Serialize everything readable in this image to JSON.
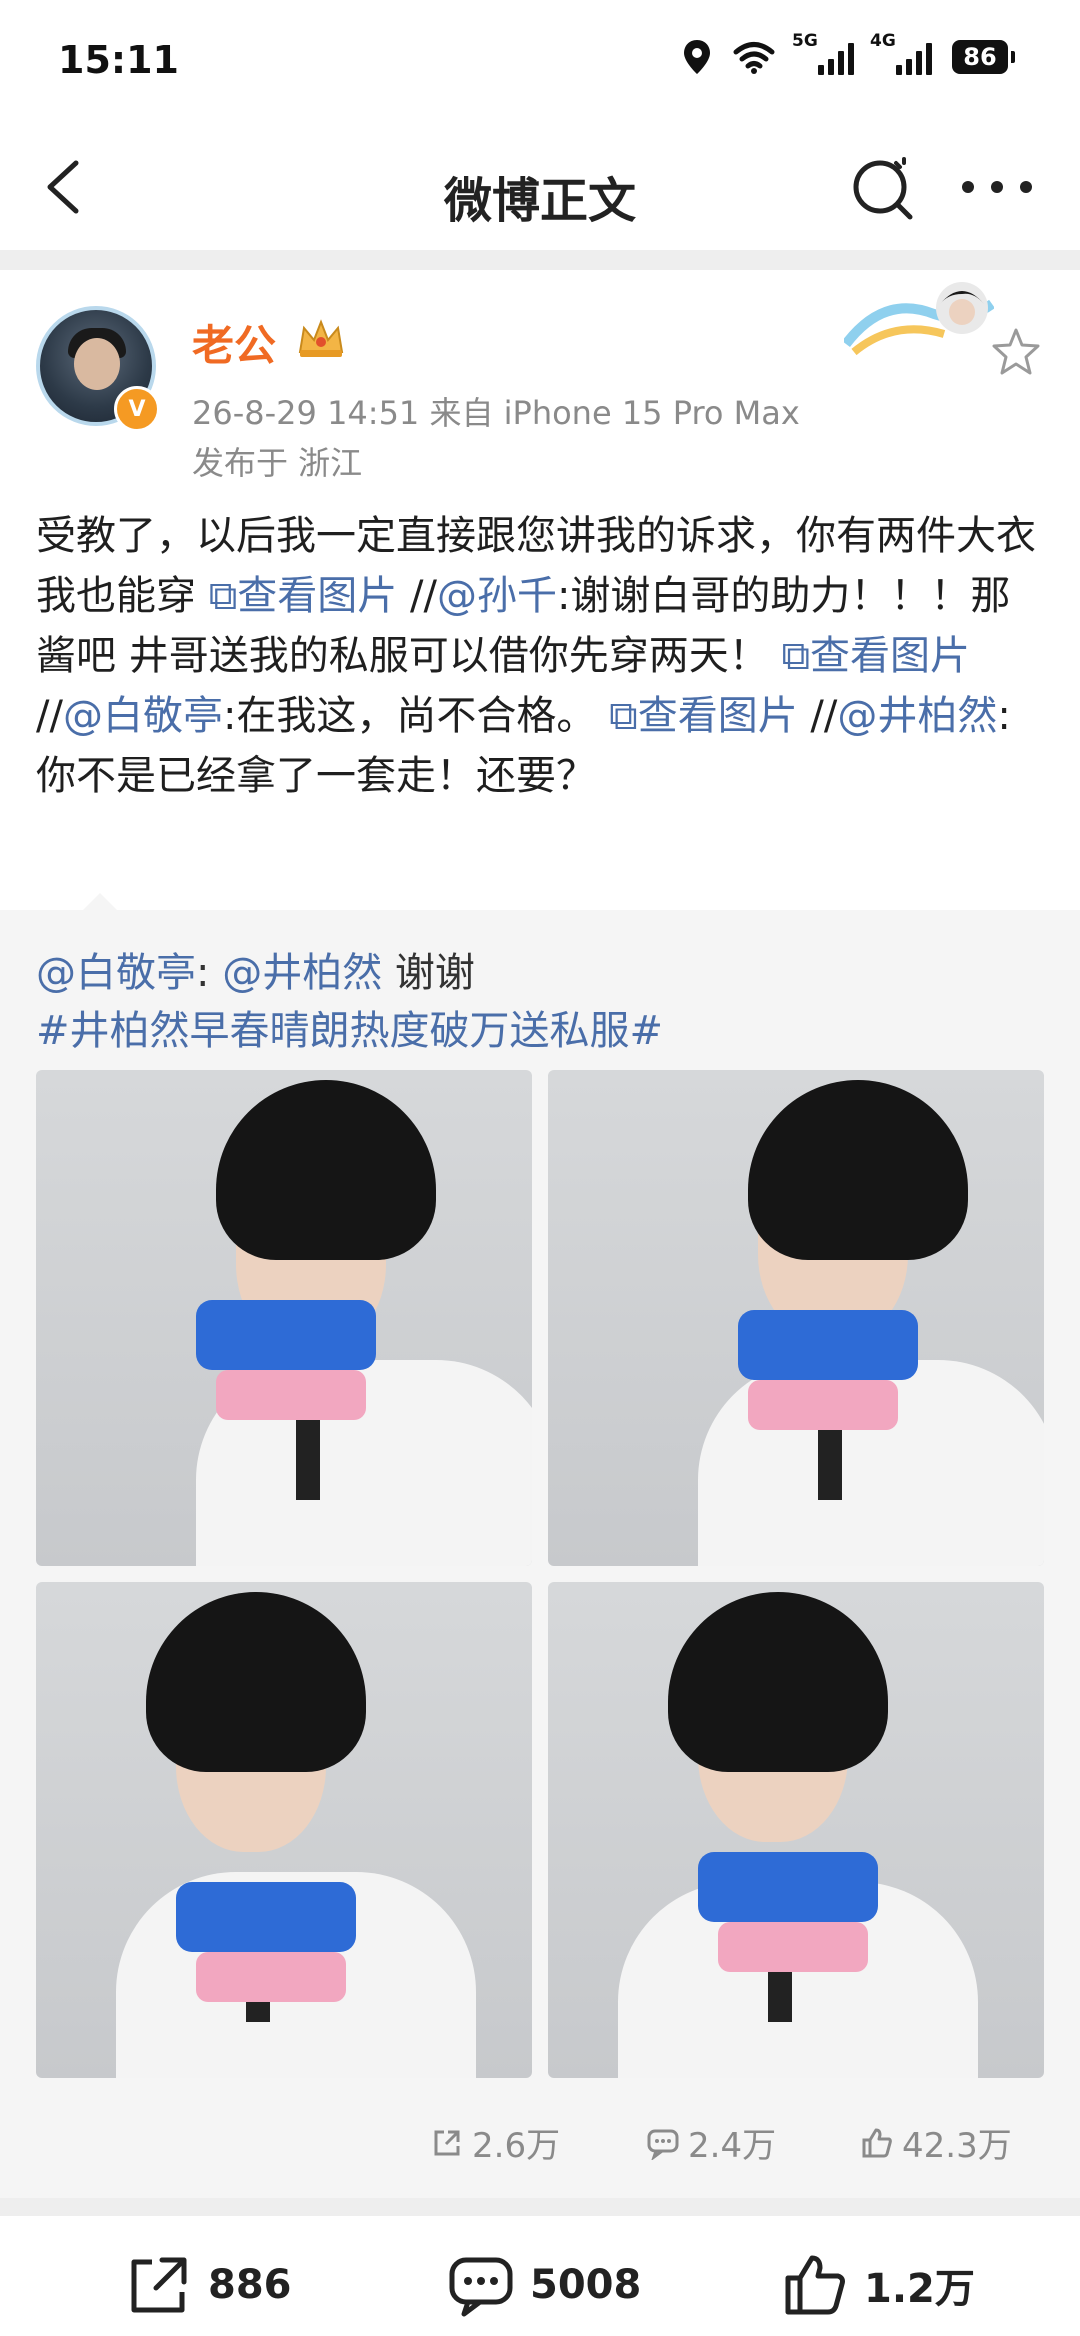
{
  "status_bar": {
    "time": "15:11",
    "signal1_label": "5G",
    "signal2_label": "4G",
    "battery": "86",
    "icons": [
      "location-icon",
      "wifi-icon",
      "signal-5g-icon",
      "signal-4g-icon",
      "battery-icon"
    ]
  },
  "nav": {
    "title": "微博正文",
    "back_icon": "chevron-left-icon",
    "search_icon": "search-icon",
    "more_icon": "more-icon"
  },
  "post": {
    "username": "老公",
    "verified_badge": "V",
    "meta": "26-8-29 14:51   来自 iPhone 15 Pro Max",
    "location": "发布于 浙江",
    "text": {
      "p1": "受教了，以后我一定直接跟您讲我的诉求，你有两件大衣我也能穿 ",
      "pic_link_1": "⧉查看图片",
      "p2": " //",
      "mention_1": "@孙千",
      "p3": ":谢谢白哥的助力！！！那酱吧 井哥送我的私服可以借你先穿两天！ ",
      "pic_link_2": "⧉查看图片",
      "p4": " //",
      "mention_2": "@白敬亭",
      "p5": ":在我这，尚不合格。 ",
      "pic_link_3": "⧉查看图片",
      "p6": " //",
      "mention_3": "@井柏然",
      "p7": ":你不是已经拿了一套走！还要？"
    }
  },
  "repost": {
    "author": "@白敬亭",
    "colon": ": ",
    "mention": "@井柏然",
    "body": " 谢谢",
    "hashtag": "#井柏然早春晴朗热度破万送私服#",
    "photos": [
      "photo-1",
      "photo-2",
      "photo-3",
      "photo-4"
    ],
    "stats": {
      "reposts": "2.6万",
      "comments": "2.4万",
      "likes": "42.3万"
    }
  },
  "bottom_bar": {
    "reposts": "886",
    "comments": "5008",
    "likes": "1.2万"
  },
  "colors": {
    "username": "#f06a23",
    "link": "#4a6ea9",
    "meta": "#8a8a8a",
    "repost_bg": "#f5f5f5"
  }
}
